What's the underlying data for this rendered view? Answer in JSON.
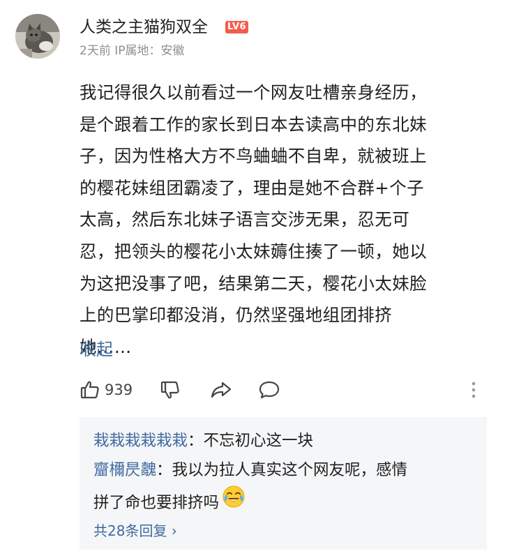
{
  "header": {
    "avatar_icon": "cat-avatar-icon",
    "username": "人类之主猫狗双全",
    "level_badge": "LV6",
    "level_badge_color": "#f25d4a",
    "meta": "2天前 IP属地：安徽"
  },
  "comment": {
    "lines": [
      "我记得很久以前看过一个网友吐槽亲身经历，",
      "是个跟着工作的家长到日本去读高中的东北妹",
      "子，因为性格大方不鸟蛐蛐不自卑，就被班上",
      "的樱花妹组团霸凌了，理由是她不合群+个子",
      "太高，然后东北妹子语言交涉无果，忍无可",
      "忍，把领头的樱花小太妹薅住揍了一顿，她以",
      "为这把没事了吧，结果第二天，樱花小太妹脸",
      "上的巴掌印都没消，仍然坚强地组团排挤",
      "她……"
    ],
    "collapse_label": "收起"
  },
  "actions": {
    "like_icon": "thumbs-up-icon",
    "like_count": "939",
    "dislike_icon": "thumbs-down-icon",
    "share_icon": "share-arrow-icon",
    "comment_icon": "speech-bubble-icon",
    "more_icon": "vertical-dots-icon"
  },
  "replies": {
    "items": [
      {
        "name": "栽栽栽栽栽栽",
        "sep": "：",
        "text": "不忘初心这一块"
      },
      {
        "name": "齏檷昃魗",
        "sep": "：",
        "text": "我以为拉人真实这个网友呢，感情",
        "text2": "拼了命也要排挤吗",
        "emoji": "crying-laughing-face-icon"
      }
    ],
    "more_label": "共28条回复 ›",
    "link_color": "#3f6aa0"
  }
}
